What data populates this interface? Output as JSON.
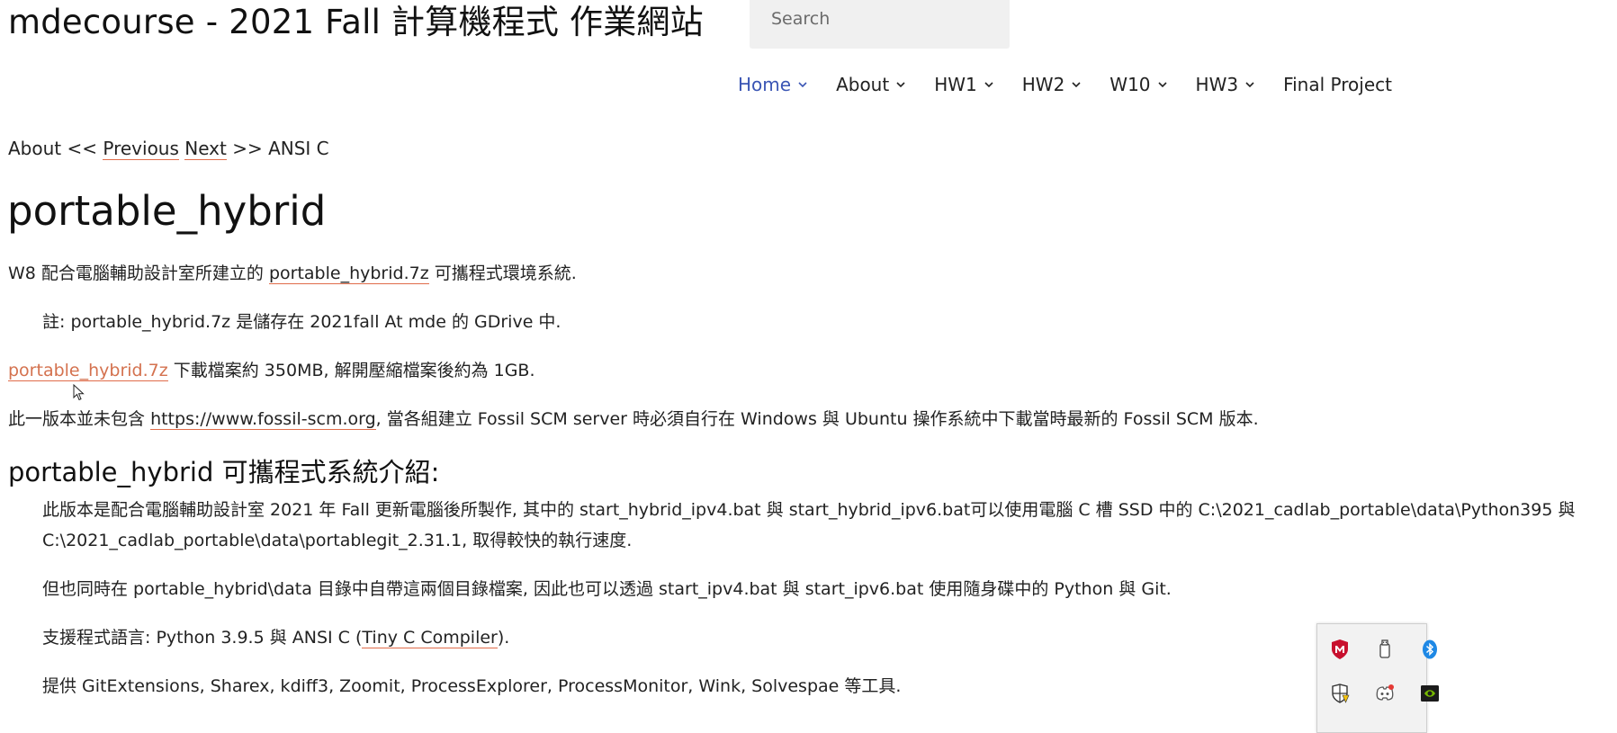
{
  "site": {
    "title": "mdecourse - 2021 Fall 計算機程式 作業網站"
  },
  "search": {
    "placeholder": "Search"
  },
  "nav": {
    "items": [
      {
        "label": "Home"
      },
      {
        "label": "About"
      },
      {
        "label": "HW1"
      },
      {
        "label": "HW2"
      },
      {
        "label": "W10"
      },
      {
        "label": "HW3"
      },
      {
        "label": "Final Project"
      }
    ]
  },
  "breadcrumb": {
    "prefix": "About <<",
    "previous": "Previous",
    "next": "Next",
    "suffix": ">> ANSI C"
  },
  "page": {
    "title": "portable_hybrid",
    "intro_pre": "W8 配合電腦輔助設計室所建立的",
    "intro_link": "portable_hybrid.7z",
    "intro_post": "可攜程式環境系統.",
    "note": "註: portable_hybrid.7z 是儲存在 2021fall At mde 的 GDrive 中.",
    "download_link": "portable_hybrid.7z",
    "download_text": "下載檔案約 350MB, 解開壓縮檔案後約為 1GB.",
    "fossil_pre": "此一版本並未包含",
    "fossil_link": "https://www.fossil-scm.org",
    "fossil_post": ", 當各組建立 Fossil SCM server 時必須自行在 Windows 與 Ubuntu 操作系統中下載當時最新的 Fossil SCM 版本.",
    "section_title": "portable_hybrid 可攜程式系統介紹:",
    "para1_line1": "此版本是配合電腦輔助設計室 2021 年 Fall 更新電腦後所製作, 其中的 start_hybrid_ipv4.bat 與 start_hybrid_ipv6.bat可以使用電腦 C 槽 SSD 中的 C:\\2021_cadlab_portable\\data\\Python395 與",
    "para1_line2": "C:\\2021_cadlab_portable\\data\\portablegit_2.31.1, 取得較快的執行速度.",
    "para2": "但也同時在 portable_hybrid\\data 目錄中自帶這兩個目錄檔案, 因此也可以透過 start_ipv4.bat 與 start_ipv6.bat 使用隨身碟中的 Python 與 Git.",
    "para3_pre": "支援程式語言: Python 3.9.5 與 ANSI C (",
    "para3_link": "Tiny C Compiler",
    "para3_post": ").",
    "para4": "提供 GitExtensions, Sharex, kdiff3, Zoomit, ProcessExplorer, ProcessMonitor, Wink, Solvespae 等工具."
  },
  "tray": {
    "icons": [
      "mcafee-icon",
      "usb-drive-icon",
      "bluetooth-icon",
      "windows-security-icon",
      "discord-icon",
      "nvidia-icon"
    ]
  },
  "colors": {
    "accent": "#3a55b4",
    "link_underline": "#e06c4a",
    "link_orange": "#d4724f"
  }
}
